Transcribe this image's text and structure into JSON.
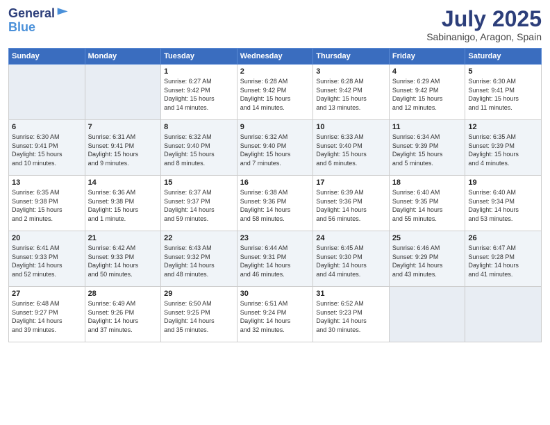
{
  "logo": {
    "line1": "General",
    "line2": "Blue"
  },
  "title": "July 2025",
  "subtitle": "Sabinanigo, Aragon, Spain",
  "weekdays": [
    "Sunday",
    "Monday",
    "Tuesday",
    "Wednesday",
    "Thursday",
    "Friday",
    "Saturday"
  ],
  "weeks": [
    [
      {
        "day": "",
        "info": ""
      },
      {
        "day": "",
        "info": ""
      },
      {
        "day": "1",
        "info": "Sunrise: 6:27 AM\nSunset: 9:42 PM\nDaylight: 15 hours\nand 14 minutes."
      },
      {
        "day": "2",
        "info": "Sunrise: 6:28 AM\nSunset: 9:42 PM\nDaylight: 15 hours\nand 14 minutes."
      },
      {
        "day": "3",
        "info": "Sunrise: 6:28 AM\nSunset: 9:42 PM\nDaylight: 15 hours\nand 13 minutes."
      },
      {
        "day": "4",
        "info": "Sunrise: 6:29 AM\nSunset: 9:42 PM\nDaylight: 15 hours\nand 12 minutes."
      },
      {
        "day": "5",
        "info": "Sunrise: 6:30 AM\nSunset: 9:41 PM\nDaylight: 15 hours\nand 11 minutes."
      }
    ],
    [
      {
        "day": "6",
        "info": "Sunrise: 6:30 AM\nSunset: 9:41 PM\nDaylight: 15 hours\nand 10 minutes."
      },
      {
        "day": "7",
        "info": "Sunrise: 6:31 AM\nSunset: 9:41 PM\nDaylight: 15 hours\nand 9 minutes."
      },
      {
        "day": "8",
        "info": "Sunrise: 6:32 AM\nSunset: 9:40 PM\nDaylight: 15 hours\nand 8 minutes."
      },
      {
        "day": "9",
        "info": "Sunrise: 6:32 AM\nSunset: 9:40 PM\nDaylight: 15 hours\nand 7 minutes."
      },
      {
        "day": "10",
        "info": "Sunrise: 6:33 AM\nSunset: 9:40 PM\nDaylight: 15 hours\nand 6 minutes."
      },
      {
        "day": "11",
        "info": "Sunrise: 6:34 AM\nSunset: 9:39 PM\nDaylight: 15 hours\nand 5 minutes."
      },
      {
        "day": "12",
        "info": "Sunrise: 6:35 AM\nSunset: 9:39 PM\nDaylight: 15 hours\nand 4 minutes."
      }
    ],
    [
      {
        "day": "13",
        "info": "Sunrise: 6:35 AM\nSunset: 9:38 PM\nDaylight: 15 hours\nand 2 minutes."
      },
      {
        "day": "14",
        "info": "Sunrise: 6:36 AM\nSunset: 9:38 PM\nDaylight: 15 hours\nand 1 minute."
      },
      {
        "day": "15",
        "info": "Sunrise: 6:37 AM\nSunset: 9:37 PM\nDaylight: 14 hours\nand 59 minutes."
      },
      {
        "day": "16",
        "info": "Sunrise: 6:38 AM\nSunset: 9:36 PM\nDaylight: 14 hours\nand 58 minutes."
      },
      {
        "day": "17",
        "info": "Sunrise: 6:39 AM\nSunset: 9:36 PM\nDaylight: 14 hours\nand 56 minutes."
      },
      {
        "day": "18",
        "info": "Sunrise: 6:40 AM\nSunset: 9:35 PM\nDaylight: 14 hours\nand 55 minutes."
      },
      {
        "day": "19",
        "info": "Sunrise: 6:40 AM\nSunset: 9:34 PM\nDaylight: 14 hours\nand 53 minutes."
      }
    ],
    [
      {
        "day": "20",
        "info": "Sunrise: 6:41 AM\nSunset: 9:33 PM\nDaylight: 14 hours\nand 52 minutes."
      },
      {
        "day": "21",
        "info": "Sunrise: 6:42 AM\nSunset: 9:33 PM\nDaylight: 14 hours\nand 50 minutes."
      },
      {
        "day": "22",
        "info": "Sunrise: 6:43 AM\nSunset: 9:32 PM\nDaylight: 14 hours\nand 48 minutes."
      },
      {
        "day": "23",
        "info": "Sunrise: 6:44 AM\nSunset: 9:31 PM\nDaylight: 14 hours\nand 46 minutes."
      },
      {
        "day": "24",
        "info": "Sunrise: 6:45 AM\nSunset: 9:30 PM\nDaylight: 14 hours\nand 44 minutes."
      },
      {
        "day": "25",
        "info": "Sunrise: 6:46 AM\nSunset: 9:29 PM\nDaylight: 14 hours\nand 43 minutes."
      },
      {
        "day": "26",
        "info": "Sunrise: 6:47 AM\nSunset: 9:28 PM\nDaylight: 14 hours\nand 41 minutes."
      }
    ],
    [
      {
        "day": "27",
        "info": "Sunrise: 6:48 AM\nSunset: 9:27 PM\nDaylight: 14 hours\nand 39 minutes."
      },
      {
        "day": "28",
        "info": "Sunrise: 6:49 AM\nSunset: 9:26 PM\nDaylight: 14 hours\nand 37 minutes."
      },
      {
        "day": "29",
        "info": "Sunrise: 6:50 AM\nSunset: 9:25 PM\nDaylight: 14 hours\nand 35 minutes."
      },
      {
        "day": "30",
        "info": "Sunrise: 6:51 AM\nSunset: 9:24 PM\nDaylight: 14 hours\nand 32 minutes."
      },
      {
        "day": "31",
        "info": "Sunrise: 6:52 AM\nSunset: 9:23 PM\nDaylight: 14 hours\nand 30 minutes."
      },
      {
        "day": "",
        "info": ""
      },
      {
        "day": "",
        "info": ""
      }
    ]
  ]
}
